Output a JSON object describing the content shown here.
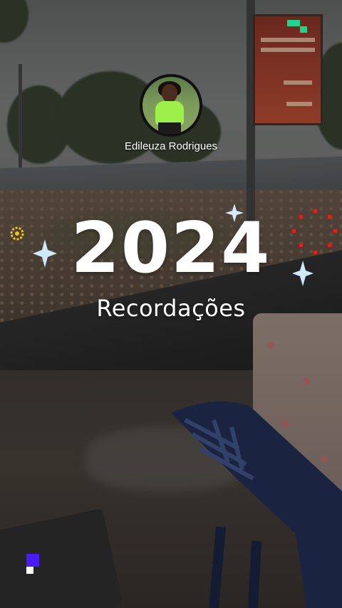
{
  "profile": {
    "username": "Edileuza Rodrigues",
    "avatar_icon": "avatar-photo"
  },
  "title": {
    "year": "2024",
    "subtitle": "Recordações"
  },
  "decorations": {
    "sparkle_color": "#bfe3ff",
    "dots_ring_color": "#e0201e",
    "gear_color": "#f2c21a",
    "pixel_accent_top": "#22d38a",
    "pixel_accent_bottom": "#4a1cf5"
  }
}
